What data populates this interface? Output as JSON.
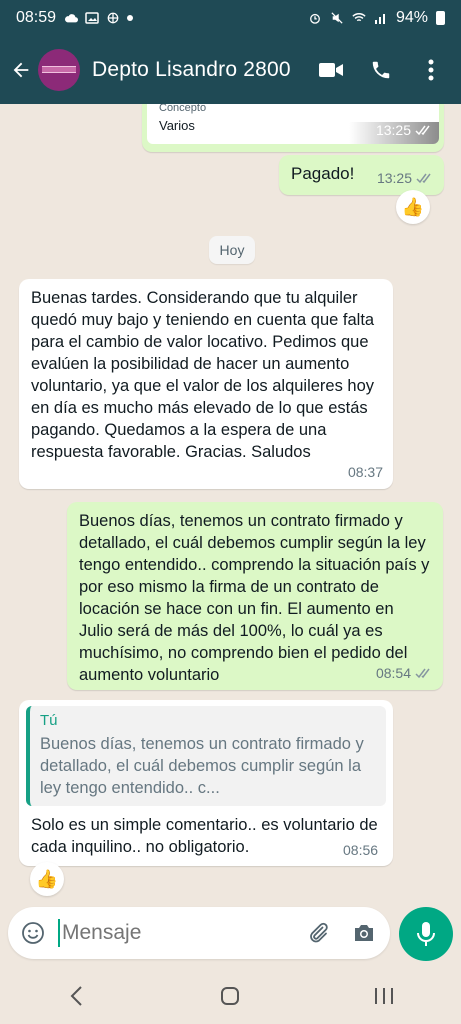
{
  "status_bar": {
    "time": "08:59",
    "battery": "94%"
  },
  "header": {
    "title": "Depto Lisandro 2800"
  },
  "messages": {
    "receipt": {
      "concept_label": "Concepto",
      "concept_value": "Varios",
      "time": "13:25"
    },
    "paid": {
      "text": "Pagado!",
      "time": "13:25",
      "reaction": "👍"
    },
    "date_chip": "Hoy",
    "landlord_request": {
      "text": "Buenas tardes. Considerando que tu alquiler quedó muy bajo y teniendo en cuenta que falta para el cambio de valor locativo. Pedimos que evalúen la posibilidad de hacer un aumento voluntario, ya que el valor de los alquileres hoy en día es mucho más elevado de lo que estás pagando. Quedamos a la espera de una respuesta favorable. Gracias. Saludos",
      "time": "08:37"
    },
    "my_reply": {
      "text": "Buenos días, tenemos un contrato firmado y detallado, el cuál debemos cumplir según la ley tengo entendido.. comprendo la situación país y por eso mismo la firma de un contrato de locación se hace con un fin. El aumento en Julio será de más del 100%, lo cuál ya es muchísimo, no comprendo bien el pedido del aumento voluntario",
      "time": "08:54"
    },
    "landlord_followup": {
      "quote_author": "Tú",
      "quote_text": "Buenos días, tenemos un contrato firmado y detallado, el cuál debemos cumplir según la ley tengo entendido.. c...",
      "text": "Solo es un simple comentario.. es voluntario de cada inquilino.. no obligatorio.",
      "time": "08:56",
      "reaction": "👍"
    }
  },
  "input": {
    "placeholder": "Mensaje"
  },
  "colors": {
    "header": "#1f4a55",
    "outgoing": "#dcf8c6",
    "incoming": "#ffffff",
    "accent": "#00a884",
    "chat_bg": "#efe7de"
  },
  "icons": [
    "back-arrow-icon",
    "video-call-icon",
    "phone-icon",
    "more-options-icon",
    "emoji-icon",
    "attach-icon",
    "camera-icon",
    "mic-icon",
    "nav-back-icon",
    "nav-home-icon",
    "nav-recents-icon"
  ]
}
